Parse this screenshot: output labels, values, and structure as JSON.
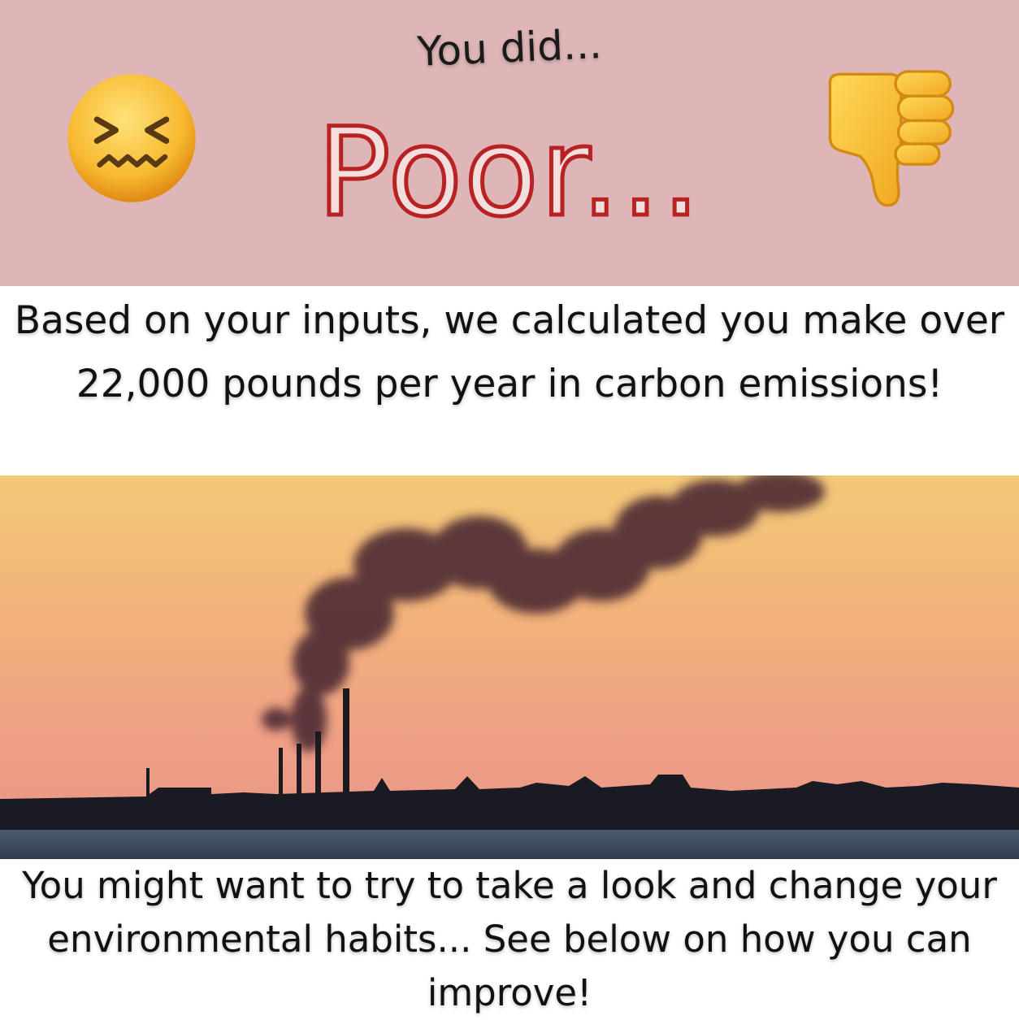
{
  "header": {
    "intro": "You did...",
    "rating": "Poor",
    "rating_suffix": "..."
  },
  "icons": {
    "left": "confounded-face-icon",
    "right": "thumbs-down-icon"
  },
  "result_message": "Based on your inputs, we calculated you make over 22,000 pounds per year in carbon emissions!",
  "photo": "smokestack-emissions-sunset-photo",
  "advice_message": "You might want to try to take a look and change your environmental habits... See below on how you can improve!",
  "colors": {
    "header_bg": "#dfb6b8",
    "rating_stroke": "#b82222",
    "rating_fill": "#f3dede"
  }
}
